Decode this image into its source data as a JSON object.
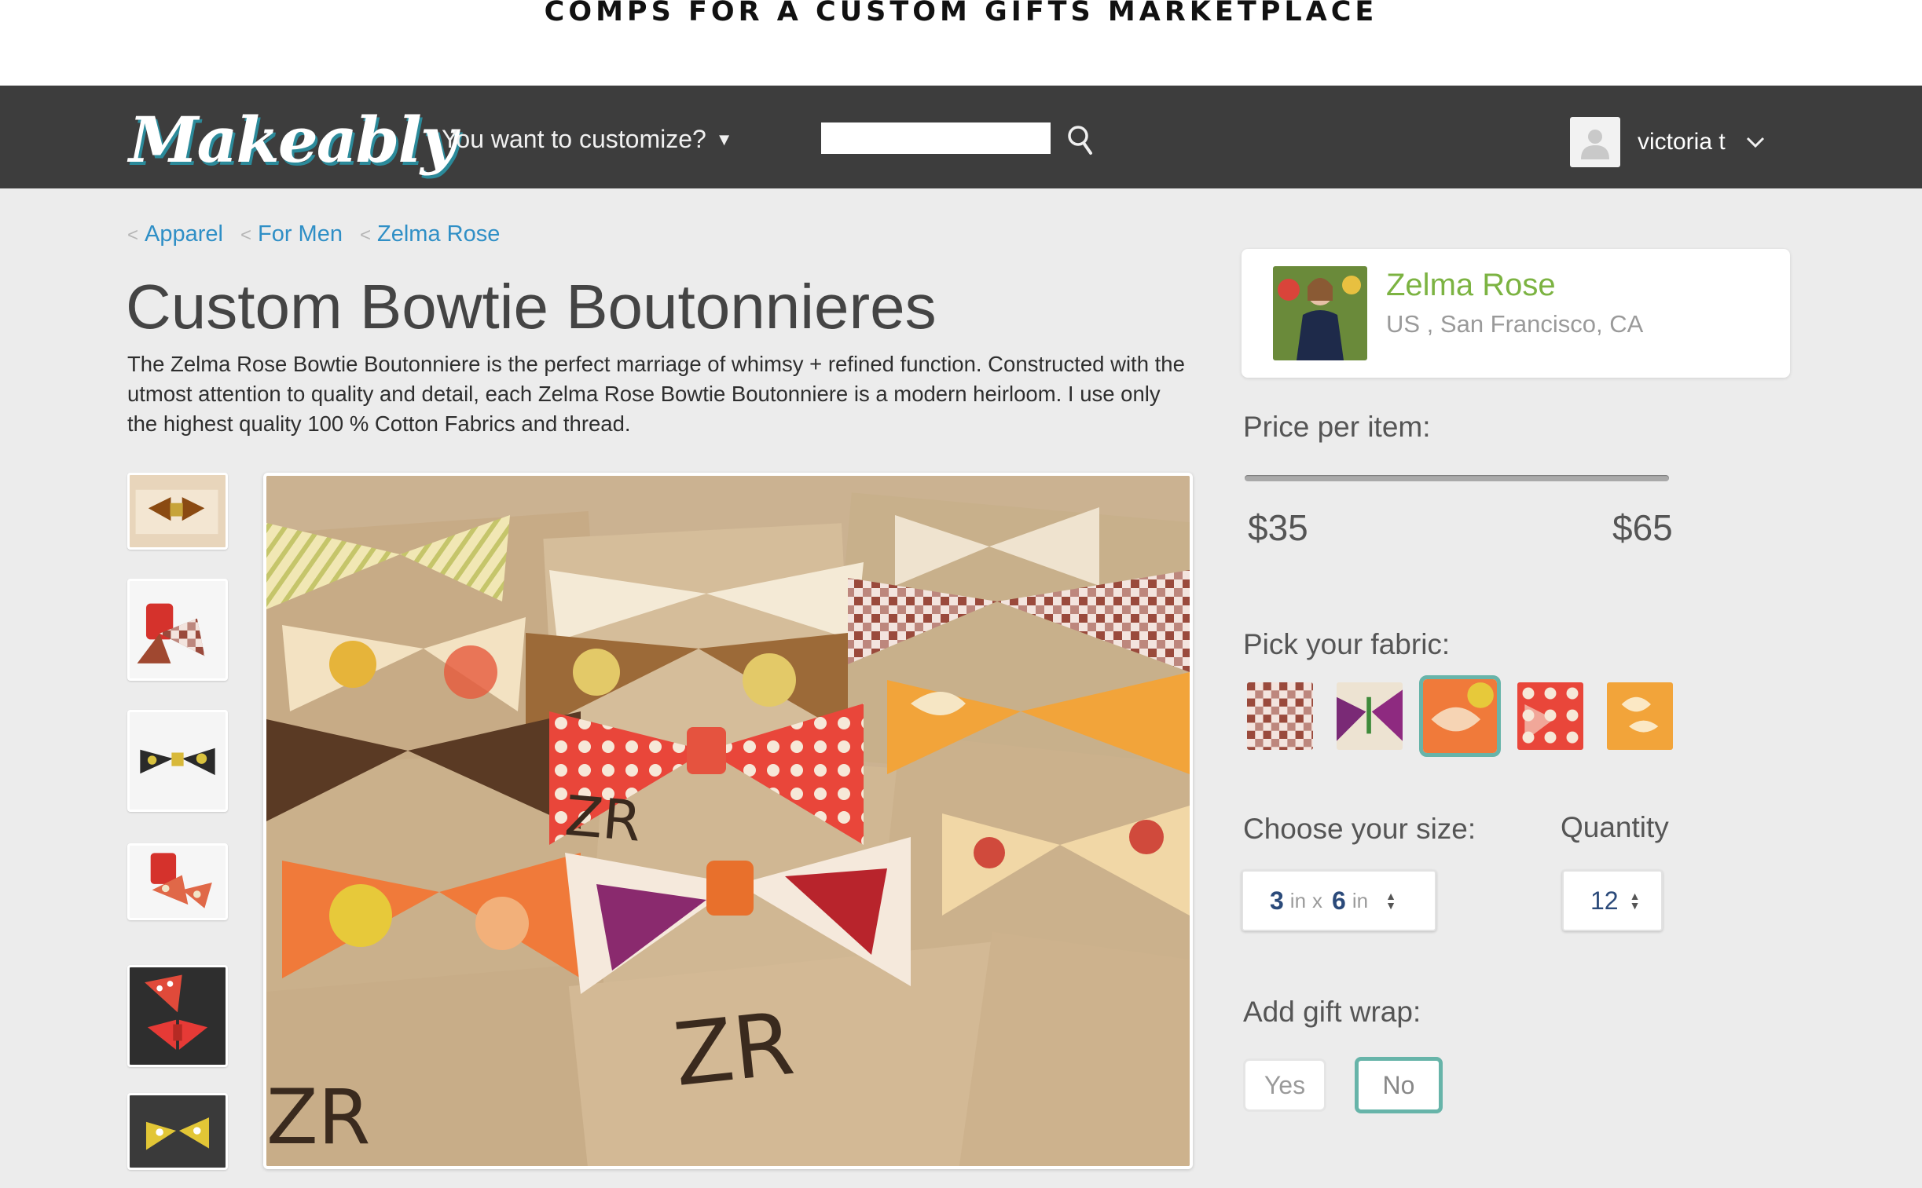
{
  "caption": "COMPS FOR A CUSTOM GIFTS MARKETPLACE",
  "navbar": {
    "logo": "Makeably",
    "customize_label": "You want to customize?",
    "search": {
      "value": "",
      "placeholder": ""
    },
    "user": {
      "name": "victoria t"
    }
  },
  "breadcrumb": [
    "Apparel",
    "For Men",
    "Zelma Rose"
  ],
  "product": {
    "title": "Custom Bowtie Boutonnieres",
    "description": "The Zelma Rose Bowtie Boutonniere is the perfect marriage of whimsy + refined function. Constructed with the utmost attention to quality and detail, each Zelma Rose Bowtie Boutonniere is a modern heirloom. I use only the highest quality 100 % Cotton Fabrics and thread.",
    "image_texts": [
      "ZR",
      "ZR",
      "ZR"
    ]
  },
  "seller": {
    "name": "Zelma Rose",
    "location": "US , San Francisco, CA"
  },
  "options": {
    "price_label": "Price per item:",
    "price_min": "$35",
    "price_max": "$65",
    "fabric_label": "Pick your fabric:",
    "selected_fabric_index": 2,
    "size_label": "Choose your size:",
    "size": {
      "w": "3",
      "w_unit": "in",
      "sep": "x",
      "h": "6",
      "h_unit": "in"
    },
    "quantity_label": "Quantity",
    "quantity": "12",
    "giftwrap_label": "Add gift wrap:",
    "giftwrap_yes": "Yes",
    "giftwrap_no": "No",
    "giftwrap_selected": "No"
  },
  "colors": {
    "navbar": "#3d3d3d",
    "link": "#2f8fc6",
    "seller_name": "#7cb342",
    "selection_accent": "#67b4a9",
    "background": "#ececec"
  }
}
